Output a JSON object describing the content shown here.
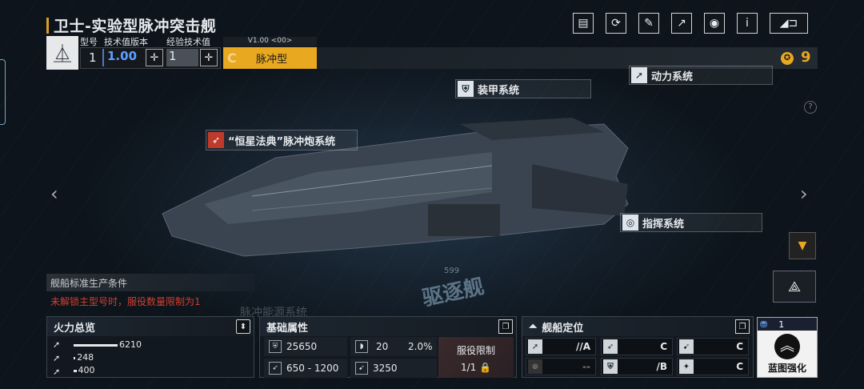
{
  "header": {
    "title": "卫士-实验型脉冲突击舰"
  },
  "toolbar": {
    "icons": [
      "blueprint-icon",
      "refresh-icon",
      "paint-icon",
      "share-icon",
      "view-icon",
      "info-icon",
      "back-icon"
    ],
    "info_label": "i"
  },
  "spec": {
    "model_label": "型号",
    "tech_label": "技术值版本",
    "exp_label": "经验技术值",
    "model_value": "1",
    "tech_value": "1.00",
    "exp_value": "1",
    "version_label": "V1.00 <00>",
    "type_grade": "C",
    "type_name": "脉冲型"
  },
  "currency": {
    "value": "9"
  },
  "systems": {
    "armor": "装甲系统",
    "power": "动力系统",
    "pulse_cannon": "“恒星法典”脉冲炮系统",
    "command": "指挥系统",
    "pulse_energy": "脉冲能源系统"
  },
  "production": {
    "title": "舰船标准生产条件",
    "warning": "未解锁主型号时，服役数量限制为1"
  },
  "ship_class": {
    "number": "599",
    "label": "驱逐舰"
  },
  "firepower": {
    "title": "火力总览",
    "rows": [
      {
        "value": "6210",
        "fill": 1.0
      },
      {
        "value": "248",
        "fill": 0.04
      },
      {
        "value": "400",
        "fill": 0.064
      }
    ]
  },
  "basic": {
    "title": "基础属性",
    "hp": "25650",
    "armor": "20",
    "armor_pct": "2.0%",
    "speed": "650 - 1200",
    "cargo": "3250",
    "service_label": "服役限制",
    "service_value": "1/1"
  },
  "position": {
    "title": "舰船定位",
    "grades": [
      "//A",
      "C",
      "C",
      "--",
      "/B",
      "C"
    ]
  },
  "blueprint": {
    "level": "1",
    "label": "蓝图强化"
  },
  "colors": {
    "accent": "#e8a820",
    "warning": "#d04030",
    "armor_grade": "#e0a020"
  }
}
